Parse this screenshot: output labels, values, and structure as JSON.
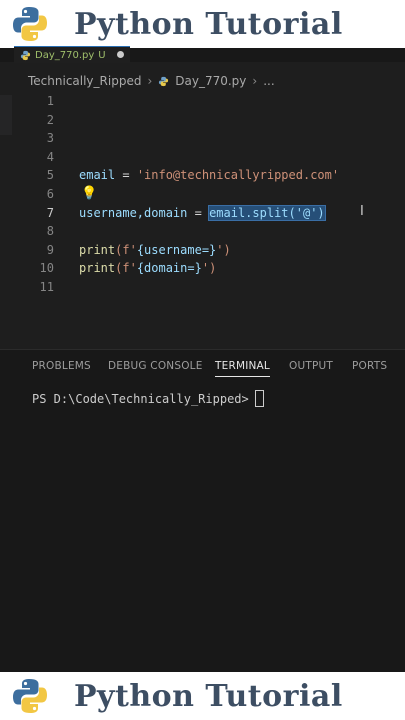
{
  "banner": {
    "title": "Python Tutorial"
  },
  "tab": {
    "filename": "Day_770.py",
    "status": "U"
  },
  "breadcrumb": {
    "folder": "Technically_Ripped",
    "file": "Day_770.py",
    "more": "..."
  },
  "editor": {
    "active_line": 7,
    "lines": [
      {
        "n": "1"
      },
      {
        "n": "2"
      },
      {
        "n": "3"
      },
      {
        "n": "4"
      },
      {
        "n": "5",
        "var": "email",
        "eq": " = ",
        "str": "'info@technicallyripped.com'"
      },
      {
        "n": "6",
        "lightbulb": true
      },
      {
        "n": "7",
        "var": "username,domain",
        "eq": " = ",
        "selected": "email.split('@')"
      },
      {
        "n": "8"
      },
      {
        "n": "9",
        "fn": "print",
        "open": "(f'",
        "brace": "{username=}",
        "close": "')"
      },
      {
        "n": "10",
        "fn": "print",
        "open": "(f'",
        "brace": "{domain=}",
        "close": "')"
      },
      {
        "n": "11"
      }
    ]
  },
  "panel": {
    "tabs": [
      "PROBLEMS",
      "DEBUG CONSOLE",
      "TERMINAL",
      "OUTPUT",
      "PORTS"
    ],
    "active_tab": "TERMINAL",
    "terminal_prompt": "PS D:\\Code\\Technically_Ripped>"
  },
  "colors": {
    "banner_text": "#3d4e63",
    "editor_bg": "#1e1e1e",
    "selection": "#264f78"
  },
  "icons": [
    "python-logo-icon",
    "python-file-icon",
    "lightbulb-icon",
    "text-cursor-icon"
  ]
}
